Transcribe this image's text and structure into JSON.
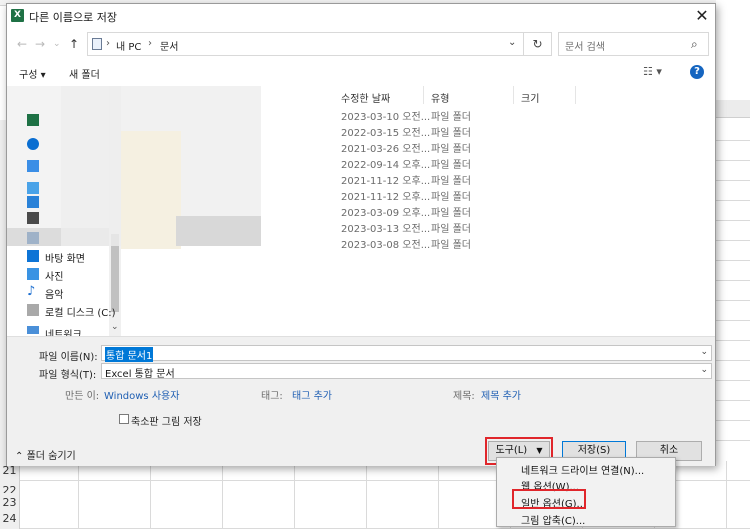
{
  "dialog": {
    "title": "다른 이름으로 저장",
    "title_icon": "X"
  },
  "address": {
    "crumb_pc": "내 PC",
    "crumb_docs": "문서",
    "search_placeholder": "문서 검색"
  },
  "toolbar": {
    "organize": "구성 ▾",
    "new_folder": "새 폴더",
    "help": "?"
  },
  "nav": {
    "items": [
      "바탕 화면",
      "사진",
      "음악",
      "로컬 디스크 (C:)",
      "네트워크"
    ]
  },
  "columns": {
    "modified": "수정한 날짜",
    "type": "유형",
    "size": "크기"
  },
  "files": [
    {
      "date": "2023-03-10 오전...",
      "type": "파일 폴더"
    },
    {
      "date": "2022-03-15 오전...",
      "type": "파일 폴더"
    },
    {
      "date": "2021-03-26 오전...",
      "type": "파일 폴더"
    },
    {
      "date": "2022-09-14 오후...",
      "type": "파일 폴더"
    },
    {
      "date": "2021-11-12 오후...",
      "type": "파일 폴더"
    },
    {
      "date": "2021-11-12 오후...",
      "type": "파일 폴더"
    },
    {
      "date": "2023-03-09 오후...",
      "type": "파일 폴더"
    },
    {
      "date": "2023-03-13 오전...",
      "type": "파일 폴더"
    },
    {
      "date": "2023-03-08 오전...",
      "type": "파일 폴더"
    }
  ],
  "form": {
    "filename_label": "파일 이름(N):",
    "filename_value": "통합 문서1",
    "filetype_label": "파일 형식(T):",
    "filetype_value": "Excel 통합 문서",
    "author_label": "만든 이:",
    "author_value": "Windows 사용자",
    "tags_label": "태그:",
    "tags_value": "태그 추가",
    "title_label": "제목:",
    "title_value": "제목 추가",
    "thumbnail_label": "축소판 그림 저장"
  },
  "buttons": {
    "hide_folders": "폴더 숨기기",
    "tools": "도구(L)",
    "save": "저장(S)",
    "cancel": "취소"
  },
  "tools_menu": [
    "네트워크 드라이브 연결(N)...",
    "웹 옵션(W)...",
    "일반 옵션(G)...",
    "그림 압축(C)..."
  ],
  "excel": {
    "rows": [
      "21",
      "22",
      "23",
      "24"
    ]
  },
  "colors": {
    "highlight": "#0078d7",
    "annotation_red": "#e0262b",
    "excel_green": "#1e7145"
  }
}
